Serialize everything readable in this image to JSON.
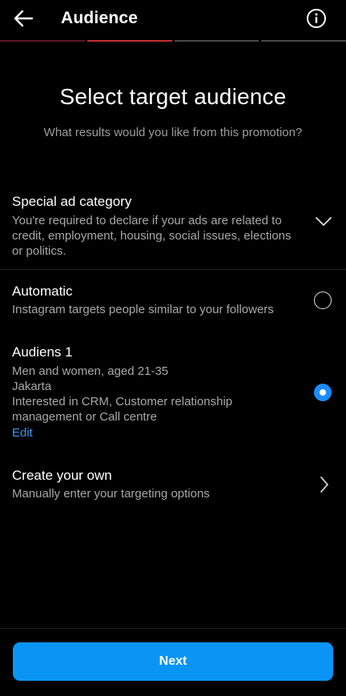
{
  "header": {
    "title": "Audience",
    "back_icon": "arrow-left-icon",
    "info_icon": "info-icon"
  },
  "progress": {
    "steps_total": 4,
    "current_step": 2
  },
  "main": {
    "heading": "Select target audience",
    "subheading": "What results would you like from this promotion?"
  },
  "special_ad_category": {
    "title": "Special ad category",
    "description": "You're required to declare if your ads are related to credit, employment, housing, social issues, elections or politics.",
    "icon": "chevron-down-icon"
  },
  "options": [
    {
      "title": "Automatic",
      "lines": [
        "Instagram targets people similar to your followers"
      ],
      "selected": false
    },
    {
      "title": "Audiens 1",
      "lines": [
        "Men and women, aged 21-35",
        "Jakarta",
        "Interested in CRM, Customer relationship management or Call centre"
      ],
      "edit_label": "Edit",
      "selected": true
    },
    {
      "title": "Create your own",
      "lines": [
        "Manually enter your targeting options"
      ],
      "icon": "chevron-right-icon"
    }
  ],
  "footer": {
    "next_label": "Next"
  },
  "colors": {
    "background": "#000000",
    "accent": "#0a95f5",
    "link": "#3897f0",
    "progress_current": "#c2302f",
    "secondary_text": "#a8a8a8"
  }
}
